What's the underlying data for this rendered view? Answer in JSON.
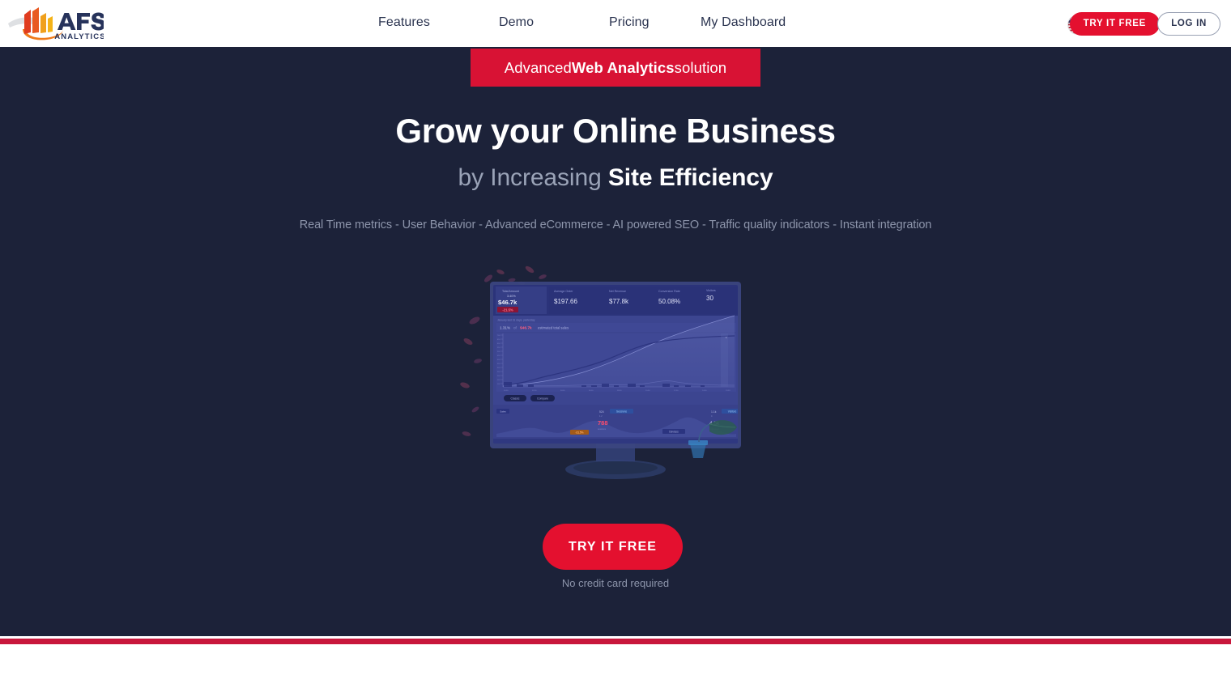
{
  "header": {
    "logo": {
      "icon": "afs-analytics-logo",
      "brand": "AFS",
      "tagline": "ANALYTICS"
    },
    "nav": [
      {
        "label": "Features",
        "name": "nav-link-features"
      },
      {
        "label": "Demo",
        "name": "nav-link-demo"
      },
      {
        "label": "Pricing",
        "name": "nav-link-pricing"
      },
      {
        "label": "My Dashboard",
        "name": "nav-link-my-dashboard"
      }
    ],
    "locale_flag": "us-flag-icon",
    "try_free_label": "TRY IT FREE",
    "login_label": "LOG IN"
  },
  "hero": {
    "ribbon": {
      "prefix": "Advanced ",
      "strong": "Web Analytics",
      "suffix": " solution"
    },
    "headline": "Grow your Online Business",
    "subheadline": {
      "muted": "by Increasing ",
      "strong": "Site Efficiency"
    },
    "features_line": "Real Time metrics - User Behavior - Advanced eCommerce - AI powered SEO - Traffic quality indicators - Instant integration",
    "cta_label": "TRY IT FREE",
    "cta_note": "No credit card required",
    "illustration": {
      "name": "analytics-dashboard-monitor-illustration",
      "screen_metrics": {
        "primary_label": "Total Amount",
        "primary_delta": "3.40%",
        "primary_value": "$46.7k",
        "primary_badge": "-21.5%",
        "avg_order_label": "Average Order",
        "avg_order_value": "$197.66",
        "revenue_label": "Net Revenue",
        "revenue_value": "$77.8k",
        "conversion_label": "Conversion Rate",
        "conversion_value": "50.08%",
        "visitors_label": "Visitors",
        "visitors_value": "30",
        "estimate_line_pct": "1.31%",
        "estimate_line_value": "$46.7k",
        "estimate_line_text": "estimated total sales",
        "bottom_value_1": "788",
        "bottom_value_2": "4.5k",
        "bottom_value_3": "1.1k"
      }
    }
  },
  "colors": {
    "dark_bg": "#1c2239",
    "accent_red": "#e4102f",
    "ribbon_red": "#d81234",
    "bottom_bar_red": "#c8173c",
    "nav_text": "#2b3450",
    "muted_text": "#8d95ab",
    "white": "#ffffff"
  }
}
